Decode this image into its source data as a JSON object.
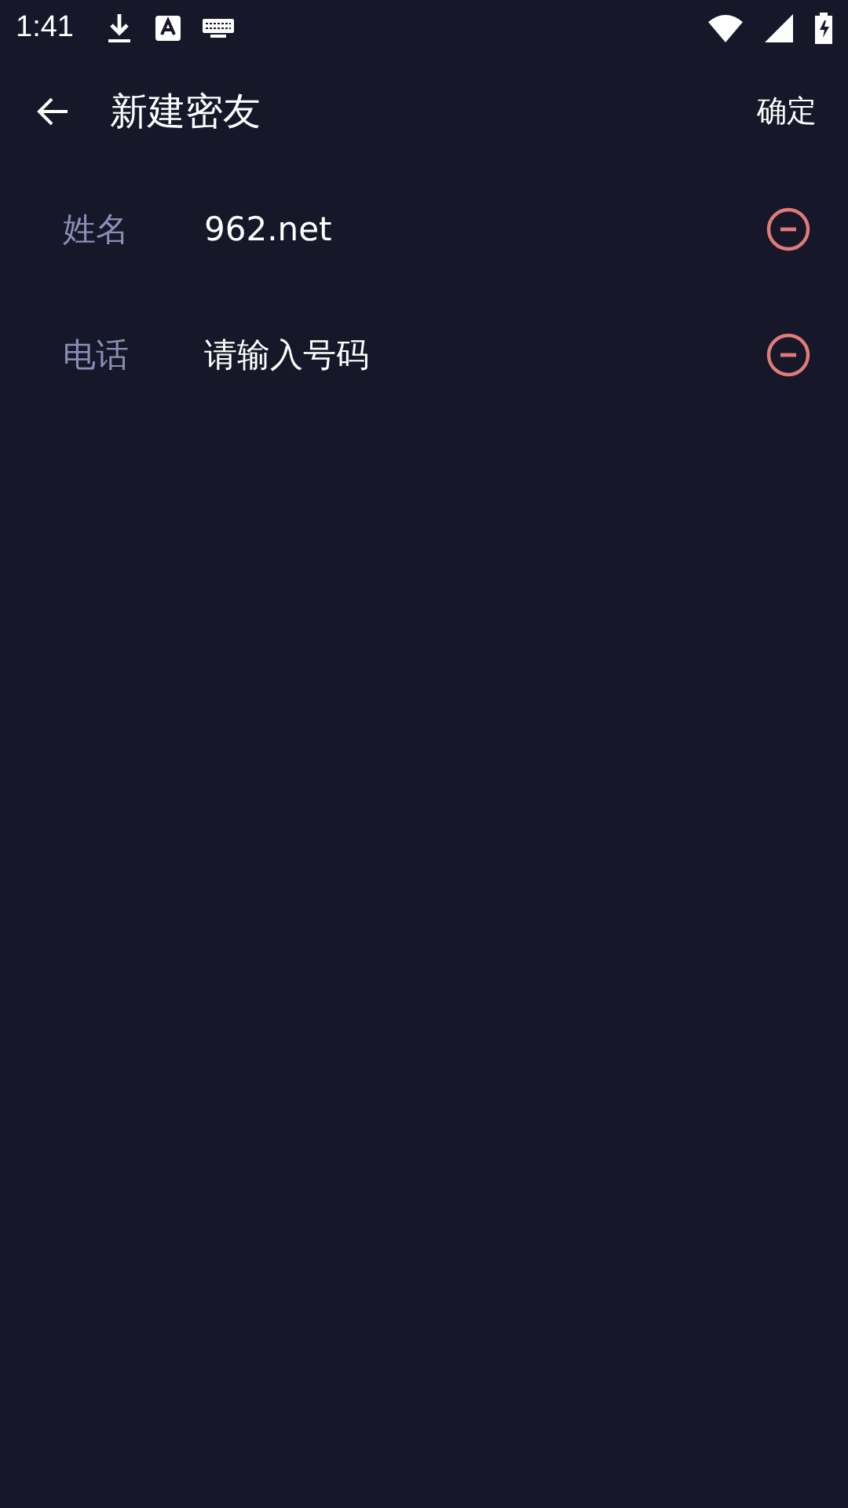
{
  "status_bar": {
    "time": "1:41"
  },
  "header": {
    "title": "新建密友",
    "confirm": "确定"
  },
  "fields": [
    {
      "label": "姓名",
      "value": "962.net"
    },
    {
      "label": "电话",
      "placeholder": "请输入号码"
    }
  ]
}
